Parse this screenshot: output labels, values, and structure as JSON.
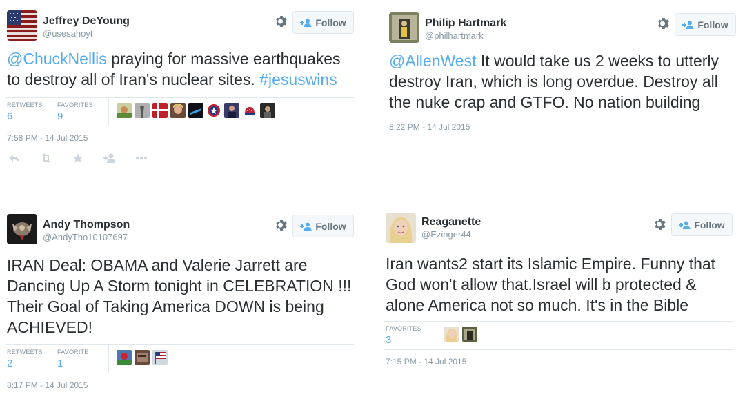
{
  "tweets": [
    {
      "name": "Jeffrey DeYoung",
      "handle": "@usesahoyt",
      "follow_label": "Follow",
      "text_mention": "@ChuckNellis",
      "text_body": " praying for massive earthquakes to destroy all of Iran's nuclear sites. ",
      "text_hashtag": "#jesuswins",
      "retweets_label": "RETWEETS",
      "retweets_count": "6",
      "favorites_label": "FAVORITES",
      "favorites_count": "9",
      "timestamp": "7:58 PM - 14 Jul 2015"
    },
    {
      "name": "Philip Hartmark",
      "handle": "@philhartmark",
      "follow_label": "Follow",
      "text_mention": "@AllenWest",
      "text_body": " It would take us 2 weeks to utterly destroy Iran, which is long overdue. Destroy all the nuke crap and GTFO.  No nation building",
      "timestamp": "8:22 PM - 14 Jul 2015"
    },
    {
      "name": "Andy Thompson",
      "handle": "@AndyTho10107697",
      "follow_label": "Follow",
      "text_body": "IRAN Deal:  OBAMA and Valerie Jarrett are Dancing Up A Storm tonight in CELEBRATION !!! Their Goal of Taking America DOWN is being ACHIEVED!",
      "retweets_label": "RETWEETS",
      "retweets_count": "2",
      "favorites_label": "FAVORITE",
      "favorites_count": "1",
      "timestamp": "8:17 PM - 14 Jul 2015"
    },
    {
      "name": "Reaganette",
      "handle": "@Ezinger44",
      "follow_label": "Follow",
      "text_body": "Iran wants2 start its Islamic Empire. Funny that God won't allow that.Israel will b protected & alone America not so much. It's in the Bible",
      "favorites_label": "FAVORITES",
      "favorites_count": "3",
      "timestamp": "7:15 PM - 14 Jul 2015"
    }
  ],
  "icons": {
    "gear": "gear-icon",
    "follow": "add-user-icon",
    "actions": [
      "reply-icon",
      "retweet-icon",
      "favorite-icon",
      "follow-icon",
      "more-icon"
    ]
  },
  "colors": {
    "link": "#55acee",
    "muted": "#8899a6",
    "text": "#292f33",
    "border": "#e1e8ed"
  }
}
